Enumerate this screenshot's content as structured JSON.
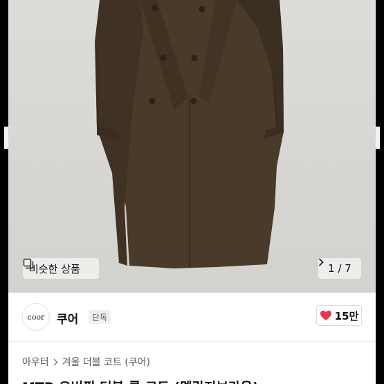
{
  "gallery": {
    "similar_label": "비슷한 상품",
    "similar_icon": "similar-items-icon",
    "counter": "1 / 7",
    "next_icon": "chevron-right-icon"
  },
  "shop": {
    "logo_text": "coor",
    "name": "쿠어",
    "badge": "단독",
    "like_icon": "heart-icon",
    "like_color": "#e8344e",
    "like_count": "15만"
  },
  "breadcrumb": {
    "items": [
      "아우터",
      "겨울 더블 코트 (쿠어)"
    ],
    "separator_icon": "chevron-right-icon"
  },
  "product": {
    "title": "MTR 오버핏 더블 롱 코트 (멜란지브라운)"
  }
}
